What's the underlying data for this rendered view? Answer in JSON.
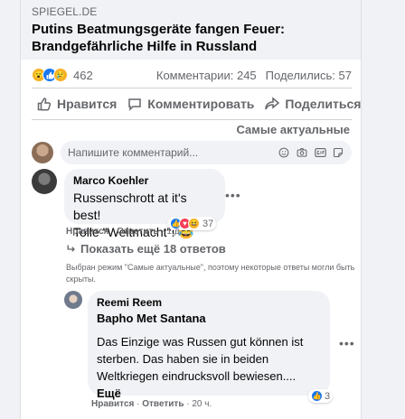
{
  "link": {
    "domain": "SPIEGEL.DE",
    "title": "Putins Beatmungsgeräte fangen Feuer: Brandgefährliche Hilfe in Russland"
  },
  "summary": {
    "reaction_count": "462",
    "comments": "Комментарии: 245",
    "shares": "Поделились: 57"
  },
  "actions": {
    "like": "Нравится",
    "comment": "Комментировать",
    "share": "Поделиться"
  },
  "sort": {
    "label": "Самые актуальные"
  },
  "composer": {
    "placeholder": "Напишите комментарий..."
  },
  "comments": [
    {
      "author": "Marco Koehler",
      "line1": "Russenschrott at it's best!",
      "line2": "Tolle \"Weltmacht\"! 😂",
      "reaction_count": "37",
      "like": "Нравится",
      "reply": "Ответить",
      "time": "1 д.",
      "replies_link": "Показать ещё 18 ответов"
    }
  ],
  "notice": "Выбран режим \"Самые актуальные\", поэтому некоторые ответы могли быть скрыты.",
  "reply": {
    "author": "Reemi Reem",
    "heading": "Bapho Met Santana",
    "line1": "Das Einzige was Russen gut können ist",
    "line2": "sterben. Das haben sie in beiden",
    "line3": "Weltkriegen eindrucksvoll bewiesen....",
    "more": "Ещё",
    "reaction_count": "3",
    "like": "Нравится",
    "reply_label": "Ответить",
    "time": "20 ч."
  },
  "colors": {
    "accent": "#1877f2",
    "muted": "#65676b",
    "bubble": "#f0f2f5"
  }
}
